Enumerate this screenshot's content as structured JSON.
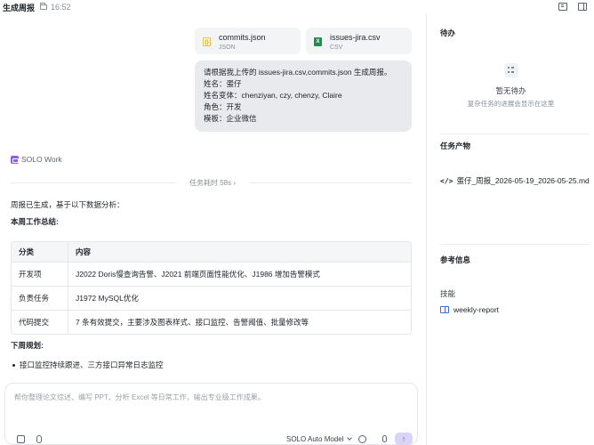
{
  "header": {
    "title": "生成周报",
    "time": "16:52"
  },
  "attachments": [
    {
      "name": "commits.json",
      "type": "JSON",
      "icon": "json-file-icon"
    },
    {
      "name": "issues-jira.csv",
      "type": "CSV",
      "icon": "excel-file-icon"
    }
  ],
  "prompt": {
    "lines": [
      "请根据我上传的 issues-jira.csv,commits.json 生成周报。",
      "姓名：蛋仔",
      "姓名变体：chenziyan, czy, chenzy, Claire",
      "角色：开发",
      "模板：企业微信"
    ]
  },
  "agent": {
    "name": "SOLO Work",
    "elapsed": "任务耗时 58s"
  },
  "response": {
    "intro": "周报已生成，基于以下数据分析：",
    "summary_heading": "本周工作总结:",
    "table": {
      "headers": [
        "分类",
        "内容"
      ],
      "rows": [
        [
          "开发项",
          "J2022 Doris慢查询告警、J2021 前端页面性能优化、J1986 增加告警模式"
        ],
        [
          "负责任务",
          "J1972 MySQL优化"
        ],
        [
          "代码提交",
          "7 条有效提交，主要涉及图表样式、接口监控、告警阈值、批量修改等"
        ]
      ]
    },
    "next_heading": "下周规划:",
    "next_items": [
      "接口监控持续跟进、三方接口异常日志监控"
    ]
  },
  "composer": {
    "placeholder": "帮你整理论文综述、编写 PPT、分析 Excel 等日常工作，输出专业级工作成果。",
    "model": "SOLO Auto Model",
    "send": "↑"
  },
  "sidebar": {
    "todo_title": "待办",
    "empty_title": "暂无待办",
    "empty_sub": "复杂任务的进展会显示在这里",
    "artifacts_title": "任务产物",
    "artifact_code": "</>",
    "artifact_file": "蛋仔_周报_2026-05-19_2026-05-25.md",
    "ref_title": "参考信息",
    "skills_label": "技能",
    "skill_name": "weekly-report"
  },
  "colors": {
    "accent": "#8b5cf6",
    "send_bg": "#d9d3f7",
    "link_blue": "#3b6fd8"
  }
}
